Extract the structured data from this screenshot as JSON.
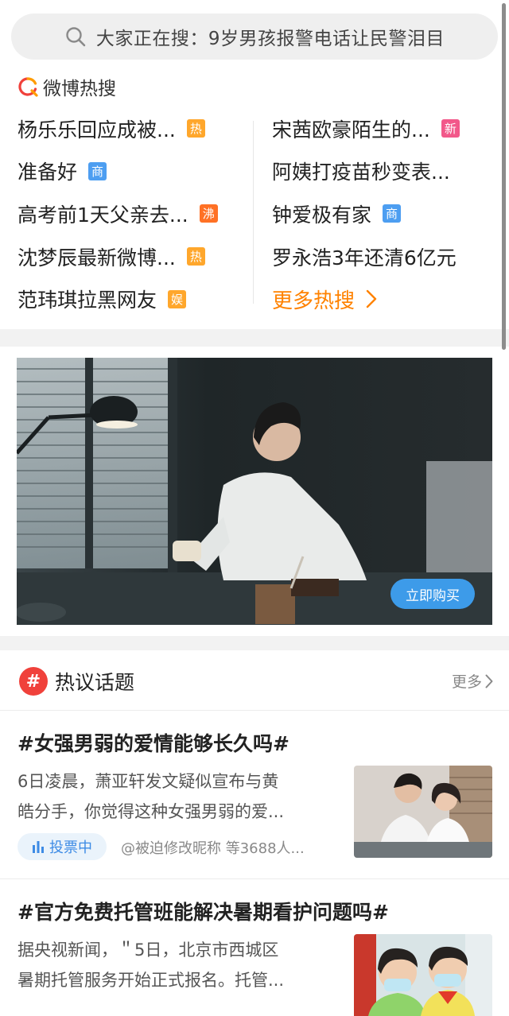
{
  "search": {
    "placeholder_text": "大家正在搜：9岁男孩报警电话让民警泪目"
  },
  "hot_search": {
    "title": "微博热搜",
    "left": [
      {
        "label": "杨乐乐回应成被...",
        "badge": "热",
        "badge_color": "#ffa72c"
      },
      {
        "label": "准备好",
        "badge": "商",
        "badge_color": "#4d9ef1"
      },
      {
        "label": "高考前1天父亲去...",
        "badge": "沸",
        "badge_color": "#ff7125"
      },
      {
        "label": "沈梦辰最新微博...",
        "badge": "热",
        "badge_color": "#ffa72c"
      },
      {
        "label": "范玮琪拉黑网友",
        "badge": "娱",
        "badge_color": "#ffa72c"
      }
    ],
    "right": [
      {
        "label": "宋茜欧豪陌生的...",
        "badge": "新",
        "badge_color": "#f2588a"
      },
      {
        "label": "阿姨打疫苗秒变表...",
        "badge": "",
        "badge_color": ""
      },
      {
        "label": "钟爱极有家",
        "badge": "商",
        "badge_color": "#4d9ef1"
      },
      {
        "label": "罗永浩3年还清6亿元",
        "badge": "",
        "badge_color": ""
      }
    ],
    "more_label": "更多热搜"
  },
  "ad": {
    "button_label": "立即购买"
  },
  "topics": {
    "title": "热议话题",
    "more_label": "更多",
    "items": [
      {
        "title": "#女强男弱的爱情能够长久吗#",
        "desc_line1": "6日凌晨，萧亚轩发文疑似宣布与黄",
        "desc_line2": "皓分手，你觉得这种女强男弱的爱...",
        "vote_label": "投票中",
        "meta": "@被迫修改昵称 等3688人..."
      },
      {
        "title": "#官方免费托管班能解决暑期看护问题吗#",
        "desc_line1": "据央视新闻，＂5日，北京市西城区",
        "desc_line2": "暑期托管服务开始正式报名。托管..."
      }
    ]
  },
  "colors": {
    "accent_orange": "#ff8200",
    "topic_red": "#f0413b",
    "ad_button_blue": "#3d9be9"
  }
}
